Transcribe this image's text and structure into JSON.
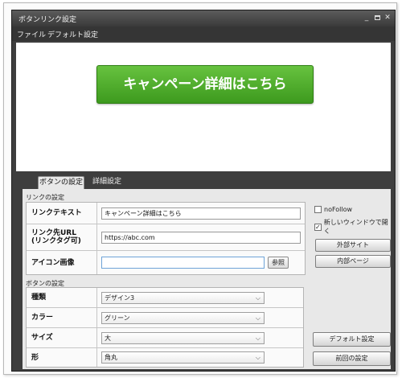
{
  "window": {
    "title": "ボタンリンク設定",
    "controls": {
      "minimize": "_",
      "close": "✕"
    }
  },
  "menu": [
    "ファイル",
    "デフォルト設定"
  ],
  "preview": {
    "button_label": "キャンペーン詳細はこちら",
    "button_color": "#4fae2a"
  },
  "tabs": [
    {
      "label": "ボタンの設定",
      "active": true
    },
    {
      "label": "詳細設定",
      "active": false
    }
  ],
  "link_section": {
    "title": "リンクの設定",
    "link_text_label": "リンクテキスト",
    "link_text_value": "キャンペーン詳細はこちら",
    "url_label": "リンク先URL\n(リンクタグ可)",
    "url_value": "https://abc.com",
    "icon_label": "アイコン画像",
    "icon_value": "",
    "browse_label": "参照"
  },
  "options": {
    "nofollow_label": "noFollow",
    "nofollow_checked": false,
    "new_window_label": "新しいウィンドウで開く",
    "new_window_checked": true,
    "new_window_mark": "✓",
    "external_site_label": "外部サイト",
    "internal_page_label": "内部ページ"
  },
  "button_section": {
    "title": "ボタンの設定",
    "type_label": "種類",
    "type_value": "デザイン3",
    "color_label": "カラー",
    "color_value": "グリーン",
    "size_label": "サイズ",
    "size_value": "大",
    "shape_label": "形",
    "shape_value": "角丸"
  },
  "actions": {
    "default_settings_label": "デフォルト設定",
    "previous_settings_label": "前回の設定"
  },
  "icons": {
    "dropdown": "chevron-down-icon",
    "check": "check-icon"
  }
}
